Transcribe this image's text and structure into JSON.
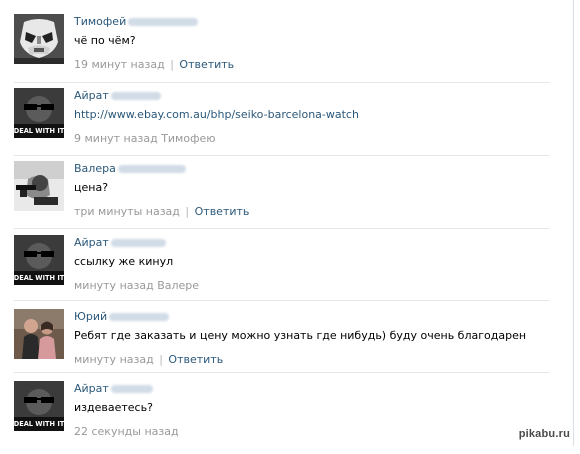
{
  "comments": [
    {
      "author": "Тимофей",
      "text": "чё по чём?",
      "time": "19 минут назад",
      "separator": "|",
      "action": "Ответить",
      "avatar": "stormtrooper-helmet",
      "colors": {
        "a": "#6f6f6f",
        "b": "#d9d9d9",
        "c": "#2b2b2b"
      }
    },
    {
      "author": "Айрат",
      "text": "http://www.ebay.com.au/bhp/seiko-barcelona-watch",
      "time": "9 минут назад",
      "action": "Тимофею",
      "avatar": "deal-with-it",
      "deal_text": "DEAL WITH IT",
      "colors": {
        "a": "#2d2d2d",
        "b": "#4f4f4f",
        "c": "#0f0f0f"
      }
    },
    {
      "author": "Валера",
      "text": "цена?",
      "time": "три минуты назад",
      "separator": "|",
      "action": "Ответить",
      "avatar": "person-with-gun",
      "colors": {
        "a": "#e9e9e9",
        "b": "#b7b7b7",
        "c": "#2a2a2a"
      }
    },
    {
      "author": "Айрат",
      "text": "ссылку же кинул",
      "time": "минуту назад",
      "action": "Валере",
      "avatar": "deal-with-it",
      "deal_text": "DEAL WITH IT",
      "colors": {
        "a": "#2d2d2d",
        "b": "#4f4f4f",
        "c": "#0f0f0f"
      }
    },
    {
      "author": "Юрий",
      "text": "Ребят где заказать и цену можно узнать где нибудь) буду очень благодарен",
      "time": "минуту назад",
      "separator": "|",
      "action": "Ответить",
      "avatar": "couple-photo",
      "colors": {
        "a": "#8b6d5a",
        "b": "#caa79a",
        "c": "#3d2c2a"
      }
    },
    {
      "author": "Айрат",
      "text": "издеваетесь?",
      "time": "22 секунды назад",
      "avatar": "deal-with-it",
      "deal_text": "DEAL WITH IT",
      "colors": {
        "a": "#2d2d2d",
        "b": "#4f4f4f",
        "c": "#0f0f0f"
      }
    }
  ],
  "watermark": "pikabu.ru"
}
